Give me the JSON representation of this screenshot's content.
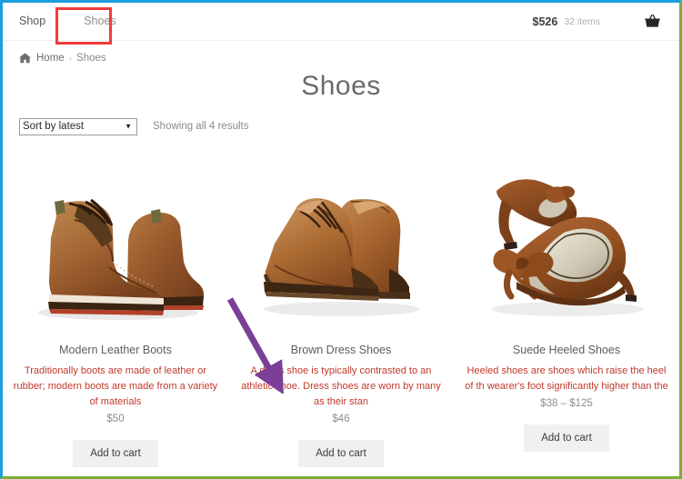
{
  "header": {
    "nav": [
      {
        "label": "Shop",
        "name": "nav-item-shop"
      },
      {
        "label": "Shoes",
        "name": "nav-item-shoes"
      }
    ],
    "cart_total": "$526",
    "cart_items": "32 items",
    "basket_icon": "basket-icon"
  },
  "breadcrumb": {
    "home_icon": "home-icon",
    "home": "Home",
    "separator": "›",
    "current": "Shoes"
  },
  "page_title": "Shoes",
  "toolbar": {
    "sort_selected": "Sort by latest",
    "sort_options": [
      "Sort by latest"
    ],
    "dropdown_arrow_icon": "chevron-down-icon",
    "result_count": "Showing all 4 results"
  },
  "products": [
    {
      "title": "Modern Leather Boots",
      "description": "Traditionally boots are made of leather or rubber; modern boots are made from a variety of materials",
      "price": "$50",
      "button_label": "Add to cart",
      "image_alt": "brown-leather-brogue-boots"
    },
    {
      "title": "Brown Dress Shoes",
      "description": "A dress shoe is typically contrasted to an athletic shoe. Dress shoes are worn by many as their stan",
      "price": "$46",
      "button_label": "Add to cart",
      "image_alt": "brown-leather-dress-shoes"
    },
    {
      "title": "Suede Heeled Shoes",
      "description": "Heeled shoes are shoes which raise the heel of th wearer's foot significantly higher than the",
      "price": "$38 – $125",
      "button_label": "Add to cart",
      "image_alt": "brown-suede-heeled-pumps"
    }
  ],
  "annotations": {
    "highlight_box_color": "#f4393c",
    "highlight_box_target": "nav-item-shoes",
    "arrow_color": "#7b3f98",
    "arrow_target": "product-brown-dress-shoes"
  },
  "colors": {
    "border_top_left": "#1b9fe0",
    "border_right_bottom": "#76b039",
    "description_text": "#c0392b",
    "button_bg": "#f0f0f0"
  }
}
